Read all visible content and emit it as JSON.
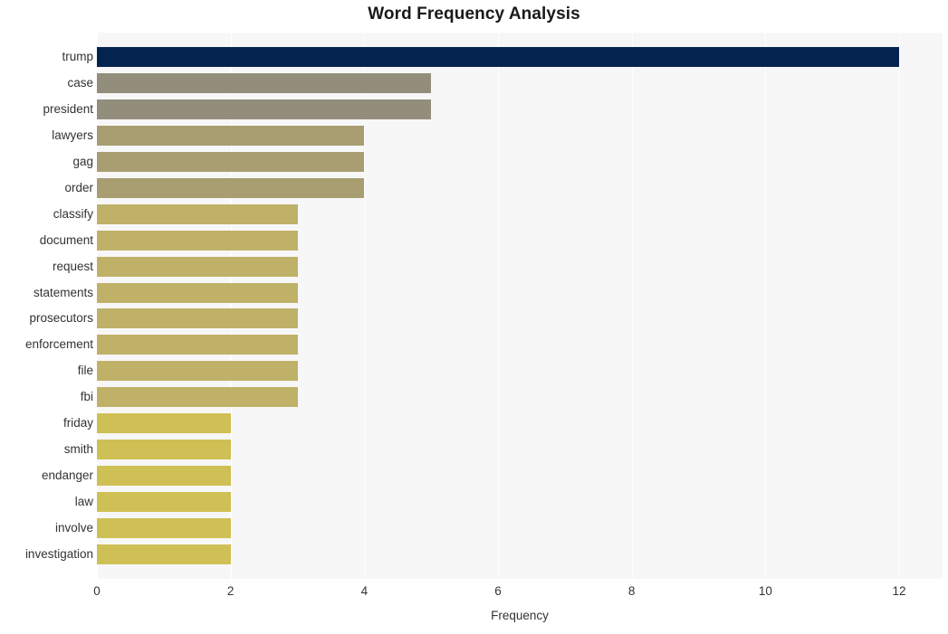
{
  "chart_data": {
    "type": "bar",
    "orientation": "horizontal",
    "title": "Word Frequency Analysis",
    "xlabel": "Frequency",
    "ylabel": "",
    "categories": [
      "trump",
      "case",
      "president",
      "lawyers",
      "gag",
      "order",
      "classify",
      "document",
      "request",
      "statements",
      "prosecutors",
      "enforcement",
      "file",
      "fbi",
      "friday",
      "smith",
      "endanger",
      "law",
      "involve",
      "investigation"
    ],
    "values": [
      12,
      5,
      5,
      4,
      4,
      4,
      3,
      3,
      3,
      3,
      3,
      3,
      3,
      3,
      2,
      2,
      2,
      2,
      2,
      2
    ],
    "bar_colors": [
      "#042450",
      "#938d7c",
      "#938d7c",
      "#a99d72",
      "#a99d72",
      "#a99d72",
      "#bfb168",
      "#bfb168",
      "#bfb168",
      "#bfb168",
      "#bfb168",
      "#bfb168",
      "#bfb168",
      "#bfb168",
      "#cfc055",
      "#cfc055",
      "#cfc055",
      "#cfc055",
      "#cfc055",
      "#cfc055"
    ],
    "xticks": [
      0,
      2,
      4,
      6,
      8,
      10,
      12
    ],
    "xtick_labels": [
      "0",
      "2",
      "4",
      "6",
      "8",
      "10",
      "12"
    ],
    "xlim": [
      0,
      12.65
    ],
    "grid": true,
    "gridline_color": "#ffffff",
    "plot_background": "#f7f7f7",
    "figure_background": "#ffffff",
    "legend": null
  }
}
